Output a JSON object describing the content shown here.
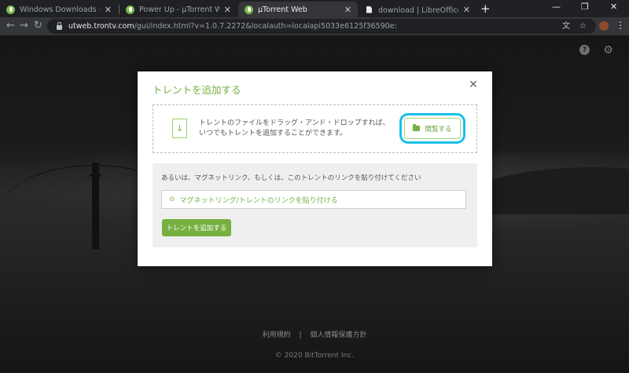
{
  "browser": {
    "tabs": [
      {
        "title": "Windows Downloads - µTorrent®",
        "favicon": "utorrent-icon",
        "active": false
      },
      {
        "title": "Power Up - µTorrent Web",
        "favicon": "utorrent-icon",
        "active": false
      },
      {
        "title": "µTorrent Web",
        "favicon": "utorrent-icon",
        "active": true
      },
      {
        "title": "download | LibreOffice - オフィスス",
        "favicon": "document-icon",
        "active": false
      }
    ],
    "new_tab_icon": "+",
    "url_host": "utweb.trontv.com",
    "url_path": "/gui/index.html?v=1.0.7.2272&localauth=localapi5033e6125f36590e:"
  },
  "page": {
    "help_icon": "?",
    "settings_icon": "⚙"
  },
  "modal": {
    "title": "トレントを追加する",
    "close_icon": "✕",
    "dropzone": {
      "line1": "トレントのファイルをドラッグ・アンド・ドロップすれば、",
      "line2": "いつでもトレントを追加することができます。",
      "browse_label": "閲覧する"
    },
    "magnet": {
      "label": "あるいは、マグネットリンク、もしくは、このトレントのリンクを貼り付けてください",
      "placeholder": "マグネットリング/トレントのリンクを貼り付ける",
      "add_button": "トレントを追加する"
    }
  },
  "footer": {
    "terms": "利用規約",
    "separator": "|",
    "privacy": "個人情報保護方針",
    "copyright": "© 2020 BitTorrent Inc."
  },
  "colors": {
    "accent_green": "#76b041",
    "highlight_ring": "#19c0e8",
    "browser_dark": "#202124"
  }
}
